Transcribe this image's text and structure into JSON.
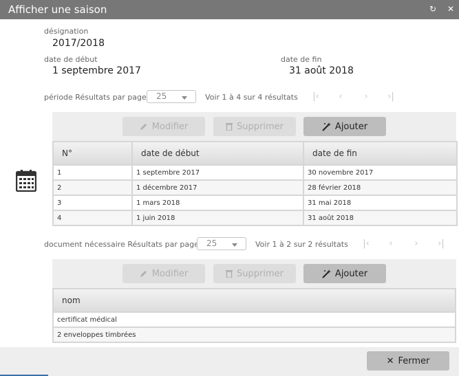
{
  "window": {
    "title": "Afficher une saison",
    "refresh_icon": "refresh-icon",
    "close_icon": "close-icon"
  },
  "form": {
    "designation_label": "désignation",
    "designation_value": "2017/2018",
    "start_label": "date de début",
    "start_value": "1 septembre 2017",
    "end_label": "date de fin",
    "end_value": "31 août 2018"
  },
  "periods": {
    "pager": {
      "label": "période Résultats par page",
      "page_size": "25",
      "info": "Voir 1 à 4 sur 4 résultats"
    },
    "toolbar": {
      "modify_label": "Modifier",
      "delete_label": "Supprimer",
      "add_label": "Ajouter"
    },
    "columns": [
      "N°",
      "date de début",
      "date de fin"
    ],
    "rows": [
      [
        "1",
        "1 septembre 2017",
        "30 novembre 2017"
      ],
      [
        "2",
        "1 décembre 2017",
        "28 février 2018"
      ],
      [
        "3",
        "1 mars 2018",
        "31 mai 2018"
      ],
      [
        "4",
        "1 juin 2018",
        "31 août 2018"
      ]
    ]
  },
  "documents": {
    "pager": {
      "label": "document nécessaire Résultats par page",
      "page_size": "25",
      "info": "Voir 1 à 2 sur 2 résultats"
    },
    "toolbar": {
      "modify_label": "Modifier",
      "delete_label": "Supprimer",
      "add_label": "Ajouter"
    },
    "columns": [
      "nom"
    ],
    "rows": [
      [
        "certificat médical"
      ],
      [
        "2 enveloppes timbrées"
      ]
    ]
  },
  "side_icon": "calendar-icon",
  "footer": {
    "close_label": "Fermer"
  }
}
